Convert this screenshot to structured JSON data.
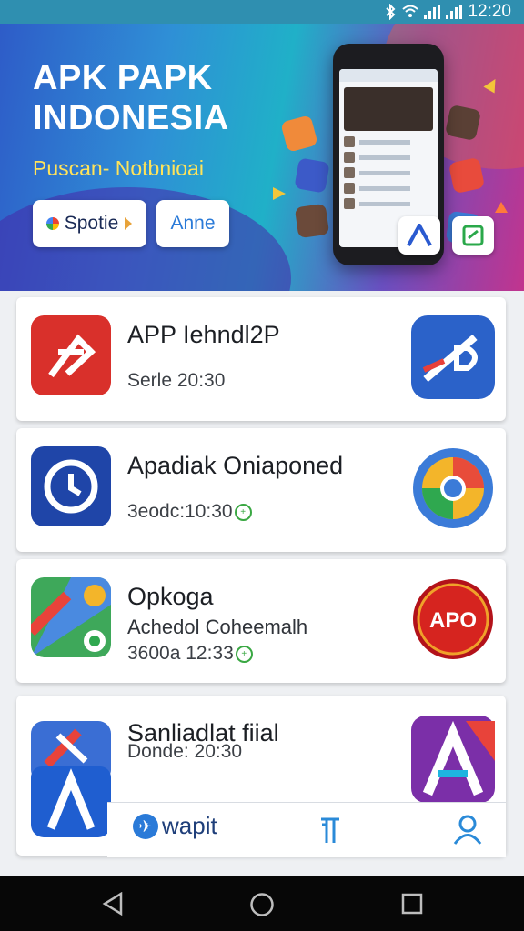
{
  "status_bar": {
    "time": "12:20",
    "icons": [
      "bluetooth-icon",
      "wifi-icon",
      "signal-icon",
      "signal-icon"
    ]
  },
  "hero": {
    "title": "APK PAPK INDONESIA",
    "subtitle": "Puscan- Notbnioai",
    "button_primary": "Spotie",
    "button_secondary": "Anne",
    "colors": {
      "subtitle": "#ffe35a",
      "accent": "#2a7ad8"
    }
  },
  "apps": [
    {
      "title": "APP Iehndl2P",
      "meta": "Serle 20:30",
      "icon": "red-arrow-app-icon",
      "right_icon": "blue-d-app-icon"
    },
    {
      "title": "Apadiak Oniaponed",
      "meta": "3eodc:10:30",
      "icon": "clock-app-icon",
      "right_icon": "chrome-icon"
    },
    {
      "title": "Opkoga",
      "subtitle": "Achedol Coheemalh",
      "meta": "3600a 12:33",
      "icon": "maps-app-icon",
      "right_icon": "apo-badge-icon",
      "badge_text": "APO"
    },
    {
      "title": "Sanliadlat fiial",
      "meta": "Donde: 20:30",
      "icon": "a-letter-app-icon",
      "right_icon": "a-letter-purple-icon"
    }
  ],
  "bottom_nav": {
    "brand": "wapit",
    "items": [
      "bookmark-icon",
      "profile-icon"
    ]
  },
  "system_nav": [
    "back-icon",
    "home-icon",
    "recents-icon"
  ]
}
